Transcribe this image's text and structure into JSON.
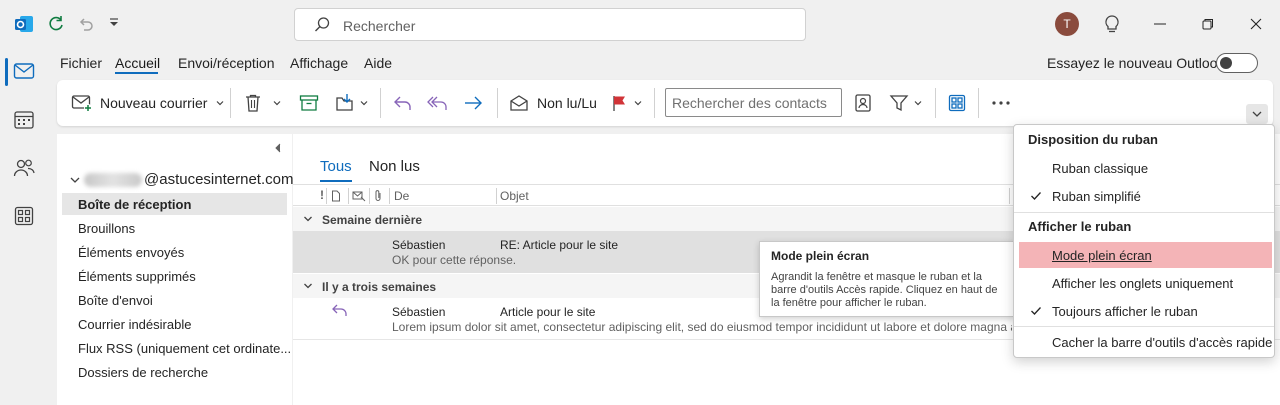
{
  "titlebar": {
    "search_placeholder": "Rechercher",
    "avatar_initial": "T"
  },
  "menu": {
    "items": [
      "Fichier",
      "Accueil",
      "Envoi/réception",
      "Affichage",
      "Aide"
    ],
    "try_new": "Essayez le nouveau Outlook"
  },
  "ribbon": {
    "new_mail": "Nouveau courrier",
    "unread_read": "Non lu/Lu",
    "contact_search_placeholder": "Rechercher des contacts"
  },
  "account": {
    "email_suffix": "@astucesinternet.com"
  },
  "folders": [
    "Boîte de réception",
    "Brouillons",
    "Éléments envoyés",
    "Éléments supprimés",
    "Boîte d'envoi",
    "Courrier indésirable",
    "Flux RSS (uniquement cet ordinate...",
    "Dossiers de recherche"
  ],
  "tabs": {
    "all": "Tous",
    "unread": "Non lus"
  },
  "columns": {
    "from": "De",
    "subject": "Objet"
  },
  "groups": {
    "last_week": "Semaine dernière",
    "three_weeks": "Il y a trois semaines"
  },
  "messages": [
    {
      "from": "Sébastien",
      "subject": "RE: Article pour le site",
      "preview": "OK pour cette réponse."
    },
    {
      "from": "Sébastien",
      "subject": "Article pour le site",
      "preview": "Lorem ipsum dolor sit amet, consectetur adipiscing elit, sed do eiusmod tempor incididunt ut labore et dolore magna aliq"
    }
  ],
  "tooltip": {
    "title": "Mode plein écran",
    "body": "Agrandit la fenêtre et masque le ruban et la barre d'outils Accès rapide. Cliquez en haut de la fenêtre pour afficher le ruban."
  },
  "dropdown": {
    "section1": "Disposition du ruban",
    "classic": "Ruban classique",
    "simplified": "Ruban simplifié",
    "section2": "Afficher le ruban",
    "fullscreen": "Mode plein écran",
    "tabs_only": "Afficher les onglets uniquement",
    "always_show": "Toujours afficher le ruban",
    "hide_qat": "Cacher la barre d'outils d'accès rapide"
  },
  "colors": {
    "accent": "#0f6cbd",
    "highlight": "#f4b4b7",
    "flag": "#d13438",
    "reply": "#8764b8"
  }
}
